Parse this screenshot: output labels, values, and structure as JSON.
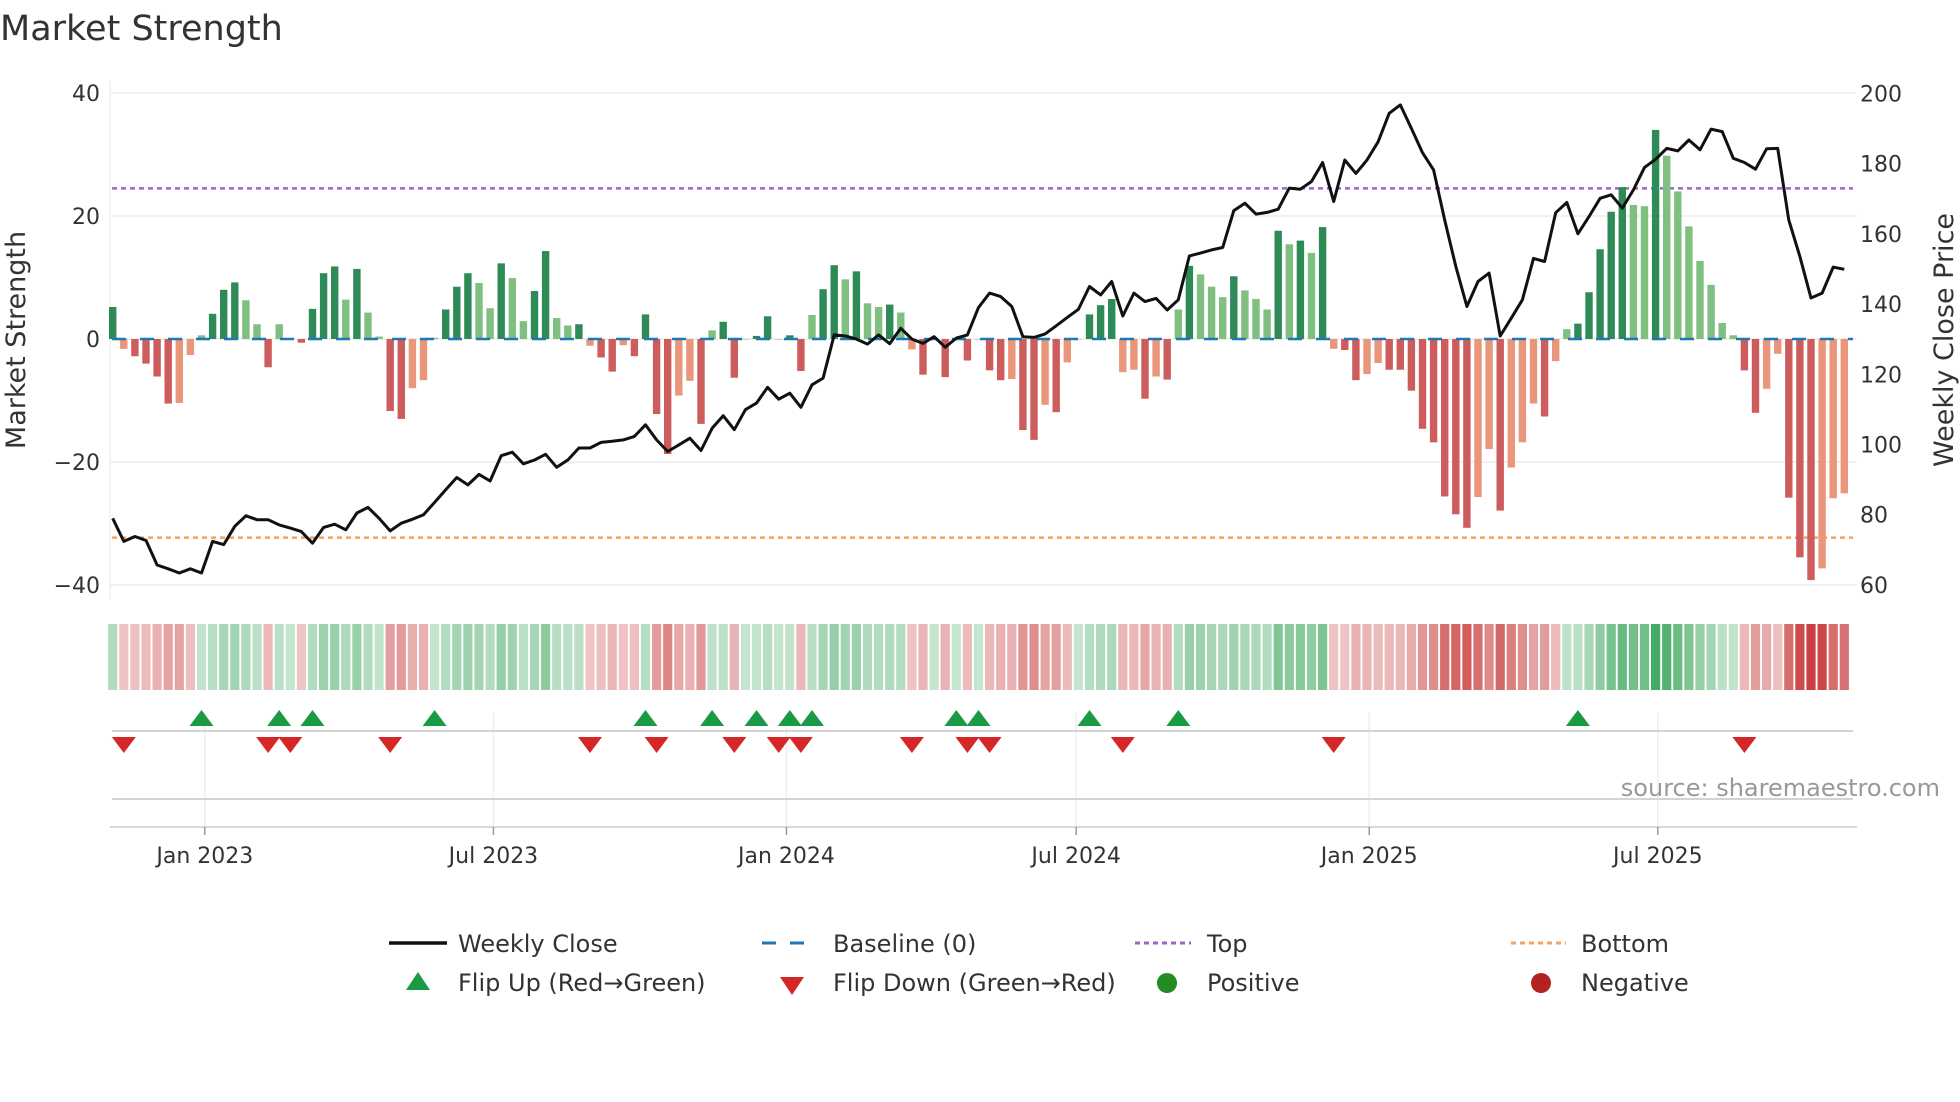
{
  "chart_data": {
    "type": "bar",
    "title": "Market Strength",
    "ylabel": "Market Strength",
    "y2label": "Weekly Close Price",
    "ylim": [
      -40,
      40
    ],
    "y2lim": [
      60,
      200
    ],
    "yticks": [
      40,
      20,
      0,
      -20,
      -40
    ],
    "y2ticks": [
      200,
      180,
      160,
      140,
      120,
      100,
      80,
      60
    ],
    "x_ticks": [
      {
        "label": "Jan 2023",
        "week": 9.3
      },
      {
        "label": "Jul 2023",
        "week": 35.3
      },
      {
        "label": "Jan 2024",
        "week": 61.7
      },
      {
        "label": "Jul 2024",
        "week": 87.8
      },
      {
        "label": "Jan 2025",
        "week": 114.2
      },
      {
        "label": "Jul 2025",
        "week": 140.2
      }
    ],
    "top_level": 24.5,
    "bottom_level": -32.3,
    "strength": [
      5.2,
      -1.6,
      -2.8,
      -4.0,
      -6.1,
      -10.5,
      -10.4,
      -2.6,
      0.6,
      4.1,
      8.0,
      9.2,
      6.3,
      2.4,
      -4.6,
      2.4,
      0,
      -0.6,
      4.9,
      10.7,
      11.8,
      6.4,
      11.4,
      4.3,
      0.4,
      -11.7,
      -13.0,
      -8.0,
      -6.7,
      0.2,
      4.8,
      8.5,
      10.7,
      9.1,
      5.0,
      12.3,
      9.9,
      2.9,
      7.8,
      14.3,
      3.4,
      2.2,
      2.4,
      -1.1,
      -3.0,
      -5.3,
      -1.0,
      -2.8,
      4.0,
      -12.2,
      -18.7,
      -9.2,
      -6.8,
      -13.8,
      1.4,
      2.8,
      -6.3,
      0,
      0.5,
      3.7,
      0,
      0.6,
      -5.2,
      3.9,
      8.1,
      12.0,
      9.7,
      11.0,
      5.8,
      5.2,
      5.6,
      4.3,
      -1.7,
      -5.8,
      0,
      -6.2,
      0,
      -3.5,
      0,
      -5.1,
      -6.7,
      -6.5,
      -14.8,
      -16.4,
      -10.7,
      -11.9,
      -3.8,
      0,
      4.0,
      5.5,
      6.5,
      -5.4,
      -5.0,
      -9.7,
      -6.1,
      -6.6,
      4.8,
      11.9,
      10.5,
      8.5,
      6.8,
      10.2,
      7.9,
      6.5,
      4.8,
      17.6,
      15.4,
      16.0,
      14.0,
      18.2,
      -1.6,
      -1.8,
      -6.7,
      -5.7,
      -3.9,
      -5.0,
      -5.0,
      -8.4,
      -14.6,
      -16.8,
      -25.6,
      -28.5,
      -30.7,
      -25.7,
      -17.9,
      -27.9,
      -20.9,
      -16.8,
      -10.5,
      -12.6,
      -3.6,
      1.6,
      2.5,
      7.6,
      14.6,
      20.7,
      24.7,
      21.8,
      21.6,
      34.0,
      29.8,
      24.0,
      18.3,
      12.7,
      8.8,
      2.6,
      0.6,
      -5.1,
      -12.0,
      -8.1,
      -2.4,
      -25.8,
      -35.5,
      -39.2,
      -37.3,
      -25.9,
      -25.1
    ],
    "weekly_close": [
      79,
      72.4,
      73.8,
      72.7,
      65.7,
      64.6,
      63.4,
      64.6,
      63.4,
      72.4,
      71.5,
      76.7,
      79.7,
      78.6,
      78.6,
      77.1,
      76.2,
      75.2,
      71.9,
      76.4,
      77.3,
      75.7,
      80.5,
      82.1,
      79.0,
      75.4,
      77.6,
      78.7,
      80.0,
      83.5,
      87.1,
      90.6,
      88.5,
      91.5,
      89.6,
      96.8,
      97.8,
      94.5,
      95.6,
      97.2,
      93.5,
      95.6,
      99.0,
      99.0,
      100.6,
      100.9,
      101.3,
      102.3,
      105.6,
      101.3,
      98.0,
      99.9,
      101.8,
      98.3,
      104.6,
      108.2,
      104.2,
      109.9,
      111.8,
      116.3,
      112.9,
      114.6,
      110.6,
      117.0,
      118.9,
      131.2,
      130.9,
      130.0,
      128.6,
      131.2,
      128.7,
      133.1,
      130.0,
      128.8,
      130.7,
      127.7,
      130.3,
      131.2,
      139.0,
      143.1,
      142.1,
      139.3,
      130.7,
      130.5,
      131.5,
      133.8,
      136.2,
      138.5,
      145.0,
      142.6,
      146.4,
      136.6,
      143.1,
      140.7,
      141.6,
      138.3,
      141.2,
      153.7,
      154.5,
      155.4,
      156.1,
      166.6,
      168.7,
      165.6,
      166.1,
      167.0,
      173.0,
      172.7,
      174.9,
      180.3,
      169.2,
      181.0,
      177.2,
      181.0,
      186.2,
      194.3,
      196.7,
      190.0,
      183.1,
      178.2,
      163.9,
      150.7,
      139.3,
      146.4,
      148.8,
      130.9,
      136.0,
      141.2,
      153.0,
      152.1,
      166.0,
      168.9,
      160.0,
      164.9,
      170.1,
      171.1,
      167.3,
      172.5,
      178.9,
      181.2,
      184.3,
      183.6,
      186.7,
      183.9,
      189.8,
      189.1,
      181.5,
      180.3,
      178.4,
      184.2,
      184.3,
      163.9,
      153.5,
      141.7,
      143.1,
      150.5,
      149.9
    ],
    "flip_up_weeks": [
      9,
      16,
      19,
      30,
      49,
      55,
      59,
      62,
      64,
      77,
      79,
      89,
      97,
      133
    ],
    "flip_down_weeks": [
      2,
      15,
      17,
      26,
      44,
      50,
      57,
      61,
      63,
      73,
      78,
      80,
      92,
      111,
      148
    ],
    "legend": {
      "weekly_close": "Weekly Close",
      "baseline": "Baseline (0)",
      "top": "Top",
      "bottom": "Bottom",
      "flip_up": "Flip Up (Red→Green)",
      "flip_down": "Flip Down (Green→Red)",
      "positive": "Positive",
      "negative": "Negative"
    },
    "legend_placement": "bottom",
    "source": "source: sharemaestro.com",
    "colors": {
      "pos_strong": "#2e8b57",
      "pos_weak": "#7fbf7f",
      "neg_strong": "#cd5c5c",
      "neg_weak": "#e9967a",
      "baseline": "#1f77b4",
      "top": "#9966cc",
      "bottom": "#f4a460",
      "flip_up": "#1a9a45",
      "flip_down": "#d62728",
      "positive": "#228b22",
      "negative": "#b22222",
      "line": "#111111"
    }
  }
}
